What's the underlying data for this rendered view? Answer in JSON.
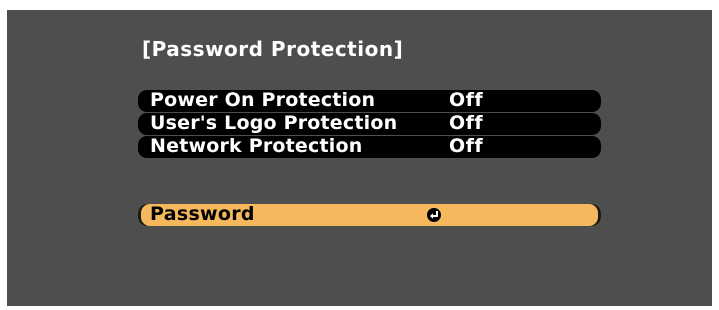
{
  "title": "[Password Protection]",
  "menu": {
    "items": [
      {
        "label": "Power On Protection",
        "value": "Off"
      },
      {
        "label": "User's Logo Protection",
        "value": "Off"
      },
      {
        "label": "Network Protection",
        "value": "Off"
      }
    ],
    "password": {
      "label": "Password",
      "icon": "enter-icon"
    }
  },
  "colors": {
    "background": "#4e4e4e",
    "row": "#000000",
    "highlight": "#f5b85c"
  }
}
